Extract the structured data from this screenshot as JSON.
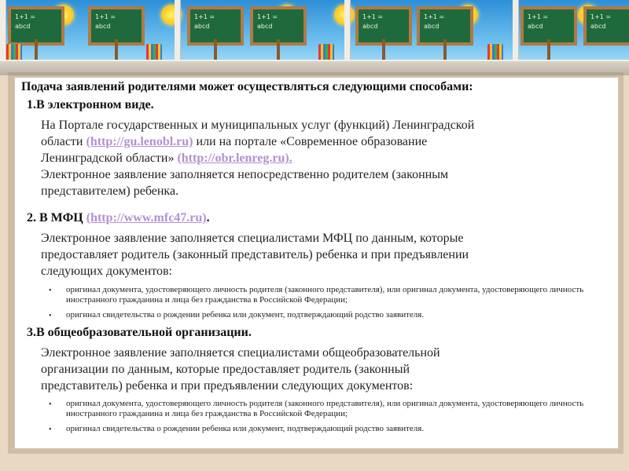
{
  "intro": "Подача заявлений родителями может осуществляться следующими способами:",
  "section1": {
    "heading": "1.В электронном виде.",
    "line1": "На Портале государственных и муниципальных услуг (функций) Ленинградской",
    "line2_pre": "области ",
    "link1": "(http://gu.lenobl.ru)",
    "line2_post": " или на портале «Современное образование",
    "line3_pre": "Ленинградской области» ",
    "link2": "(http://obr.lenreg.ru).",
    "line4": "Электронное заявление заполняется непосредственно родителем (законным",
    "line5": "представителем) ребенка."
  },
  "section2": {
    "heading_pre": "2. В МФЦ ",
    "link": "(http://www.mfc47.ru)",
    "heading_post": ".",
    "line1": "Электронное заявление заполняется специалистами МФЦ по данным, которые",
    "line2": "предоставляет родитель (законный представитель) ребенка и при предъявлении",
    "line3": "следующих документов:",
    "bullets": [
      "оригинал документа, удостоверяющего личность родителя (законного представителя), или оригинал документа, удостоверяющего личность иностранного гражданина и лица без гражданства в Российской Федерации;",
      "оригинал свидетельства о рождении ребенка или документ, подтверждающий родство заявителя."
    ]
  },
  "section3": {
    "heading": "3.В общеобразовательной организации.",
    "line1": "Электронное заявление заполняется специалистами общеобразовательной",
    "line2": "организации по данным, которые предоставляет родитель (законный",
    "line3": "представитель) ребенка и при предъявлении следующих документов:",
    "bullets": [
      "оригинал документа, удостоверяющего личность родителя (законного представителя), или оригинал документа, удостоверяющего личность иностранного гражданина и лица без гражданства в Российской Федерации;",
      "оригинал свидетельства о рождении ребенка или документ, подтверждающий родство заявителя."
    ]
  },
  "bullet_glyph": "•",
  "board_text": [
    "1+1 =",
    "abcd"
  ],
  "colors": {
    "link": "#b48fd1",
    "sky": "#4aa6e3",
    "board": "#1f6a3c"
  }
}
